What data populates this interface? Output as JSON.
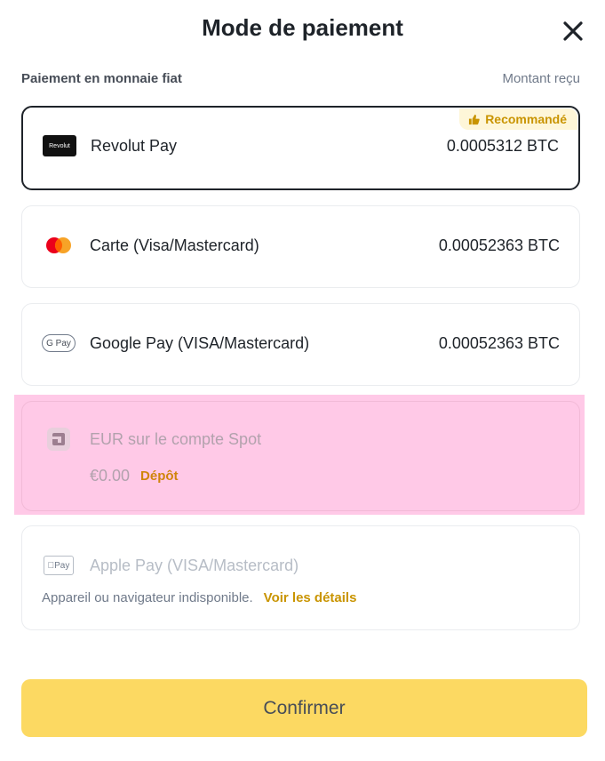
{
  "header": {
    "title": "Mode de paiement"
  },
  "subheader": {
    "left": "Paiement en monnaie fiat",
    "right": "Montant reçu"
  },
  "methods": [
    {
      "name": "Revolut Pay",
      "logo_text": "Revolut",
      "amount": "0.0005312 BTC",
      "badge": "Recommandé",
      "selected": true
    },
    {
      "name": "Carte (Visa/Mastercard)",
      "amount": "0.00052363 BTC"
    },
    {
      "name": "Google Pay (VISA/Mastercard)",
      "logo_text": "G Pay",
      "amount": "0.00052363 BTC"
    },
    {
      "name": "EUR sur le compte Spot",
      "balance": "€0.00",
      "action": "Dépôt"
    },
    {
      "name": "Apple Pay (VISA/Mastercard)",
      "logo_text": "Pay",
      "note": "Appareil ou navigateur indisponible.",
      "link": "Voir les détails"
    }
  ],
  "footer": {
    "confirm_label": "Confirmer"
  },
  "colors": {
    "accent": "#fcd962",
    "badge_text": "#c99400",
    "highlight": "#ffc9e7"
  }
}
